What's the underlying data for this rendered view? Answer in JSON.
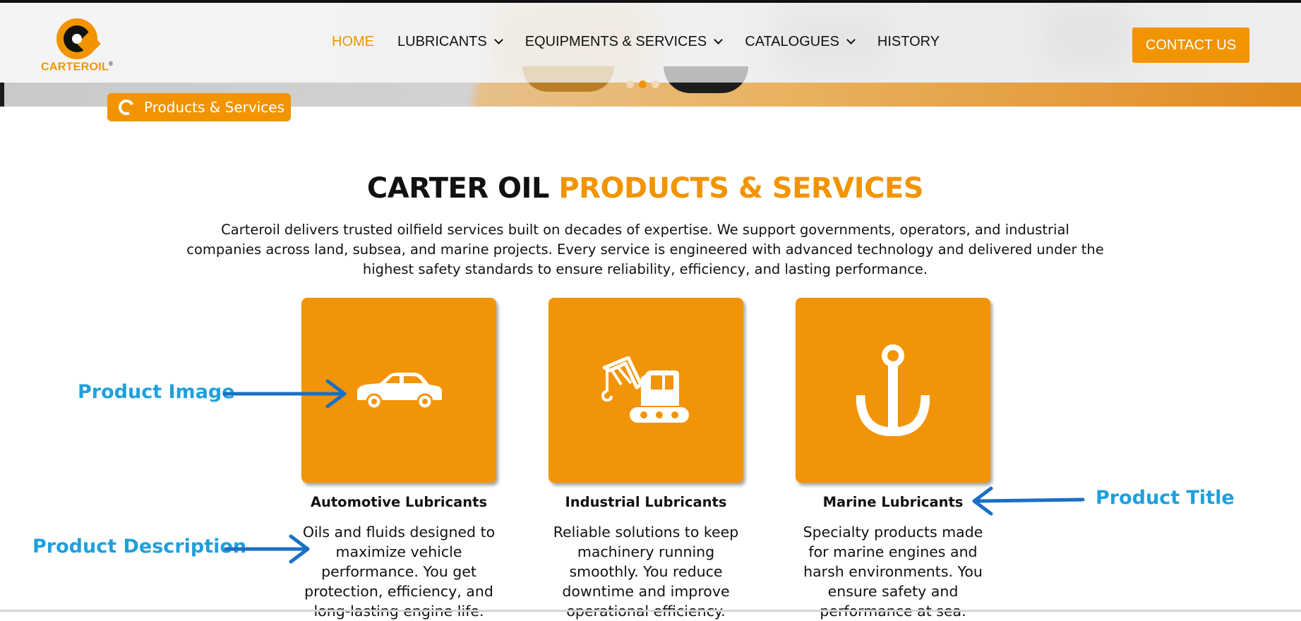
{
  "brand": {
    "name": "CARTEROIL",
    "mark": "®"
  },
  "nav": {
    "items": [
      {
        "label": "HOME",
        "active": true,
        "dropdown": false
      },
      {
        "label": "LUBRICANTS",
        "active": false,
        "dropdown": true
      },
      {
        "label": "EQUIPMENTS & SERVICES",
        "active": false,
        "dropdown": true
      },
      {
        "label": "CATALOGUES",
        "active": false,
        "dropdown": true
      },
      {
        "label": "HISTORY",
        "active": false,
        "dropdown": false
      }
    ],
    "contact_label": "CONTACT US"
  },
  "slider": {
    "dots": 3,
    "active_index": 1
  },
  "breadcrumb": {
    "label": "Products & Services"
  },
  "heading": {
    "part1": "CARTER OIL",
    "part2": "PRODUCTS & SERVICES"
  },
  "intro": {
    "line1": "Carteroil delivers trusted oilfield services built on decades of expertise. We support governments, operators, and industrial",
    "line2": "companies across land, subsea, and marine projects. Every service is engineered with advanced technology and delivered under the",
    "line3": "highest safety standards to ensure reliability, efficiency, and lasting performance."
  },
  "products": [
    {
      "title": "Automotive Lubricants",
      "icon": "car-icon",
      "desc": [
        "Oils and fluids designed to",
        "maximize vehicle",
        "performance. You get",
        "protection, efficiency, and",
        "long-lasting engine life."
      ]
    },
    {
      "title": "Industrial Lubricants",
      "icon": "crane-icon",
      "desc": [
        "Reliable solutions to keep",
        "machinery running",
        "smoothly. You reduce",
        "downtime and improve",
        "operational efficiency."
      ]
    },
    {
      "title": "Marine Lubricants",
      "icon": "anchor-icon",
      "desc": [
        "Specialty products made",
        "for marine engines and",
        "harsh environments. You",
        "ensure safety and",
        "performance at sea."
      ]
    }
  ],
  "annotations": {
    "image": "Product Image",
    "title": "Product Title",
    "description": "Product Description"
  },
  "colors": {
    "accent": "#f29400",
    "annotation": "#1fa0dc",
    "arrow": "#1a6fc4",
    "text": "#111111"
  }
}
